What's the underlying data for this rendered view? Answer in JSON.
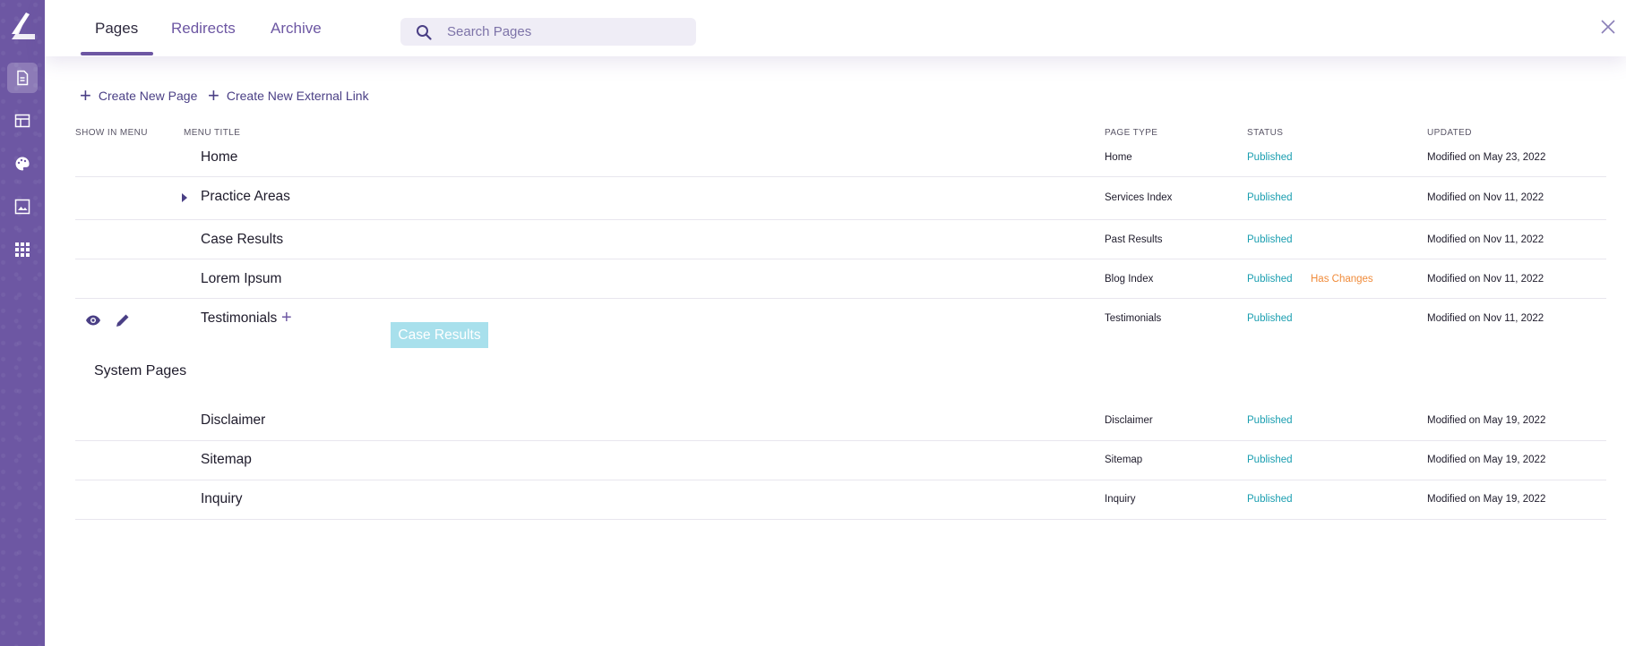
{
  "header": {
    "tabs": [
      {
        "label": "Pages",
        "active": true
      },
      {
        "label": "Redirects",
        "active": false
      },
      {
        "label": "Archive",
        "active": false
      }
    ],
    "search": {
      "placeholder": "Search Pages",
      "value": ""
    }
  },
  "actions": {
    "create_page": "Create New Page",
    "create_link": "Create New External Link"
  },
  "columns": {
    "show_in_menu": "SHOW IN MENU",
    "menu_title": "MENU TITLE",
    "page_type": "PAGE TYPE",
    "status": "STATUS",
    "updated": "UPDATED"
  },
  "menu_pages": [
    {
      "title": "Home",
      "page_type": "Home",
      "status": "Published",
      "changes": "",
      "updated": "Modified on May 23, 2022"
    },
    {
      "title": "Practice Areas",
      "page_type": "Services Index",
      "status": "Published",
      "changes": "",
      "updated": "Modified on Nov 11, 2022"
    },
    {
      "title": "Case Results",
      "page_type": "Past Results",
      "status": "Published",
      "changes": "",
      "updated": "Modified on Nov 11, 2022"
    },
    {
      "title": "Lorem Ipsum",
      "page_type": "Blog Index",
      "status": "Published",
      "changes": "Has Changes",
      "updated": "Modified on Nov 11, 2022"
    },
    {
      "title": "Testimonials",
      "page_type": "Testimonials",
      "status": "Published",
      "changes": "",
      "updated": "Modified on Nov 11, 2022"
    }
  ],
  "drag_ghost": "Case Results",
  "system_section": "System Pages",
  "system_pages": [
    {
      "title": "Disclaimer",
      "page_type": "Disclaimer",
      "status": "Published",
      "updated": "Modified on May 19, 2022"
    },
    {
      "title": "Sitemap",
      "page_type": "Sitemap",
      "status": "Published",
      "updated": "Modified on May 19, 2022"
    },
    {
      "title": "Inquiry",
      "page_type": "Inquiry",
      "status": "Published",
      "updated": "Modified on May 19, 2022"
    }
  ],
  "colors": {
    "sidebar": "#6d57a3",
    "accent": "#6d57a3",
    "published": "#1a9eb0",
    "has_changes": "#f08b3a"
  }
}
